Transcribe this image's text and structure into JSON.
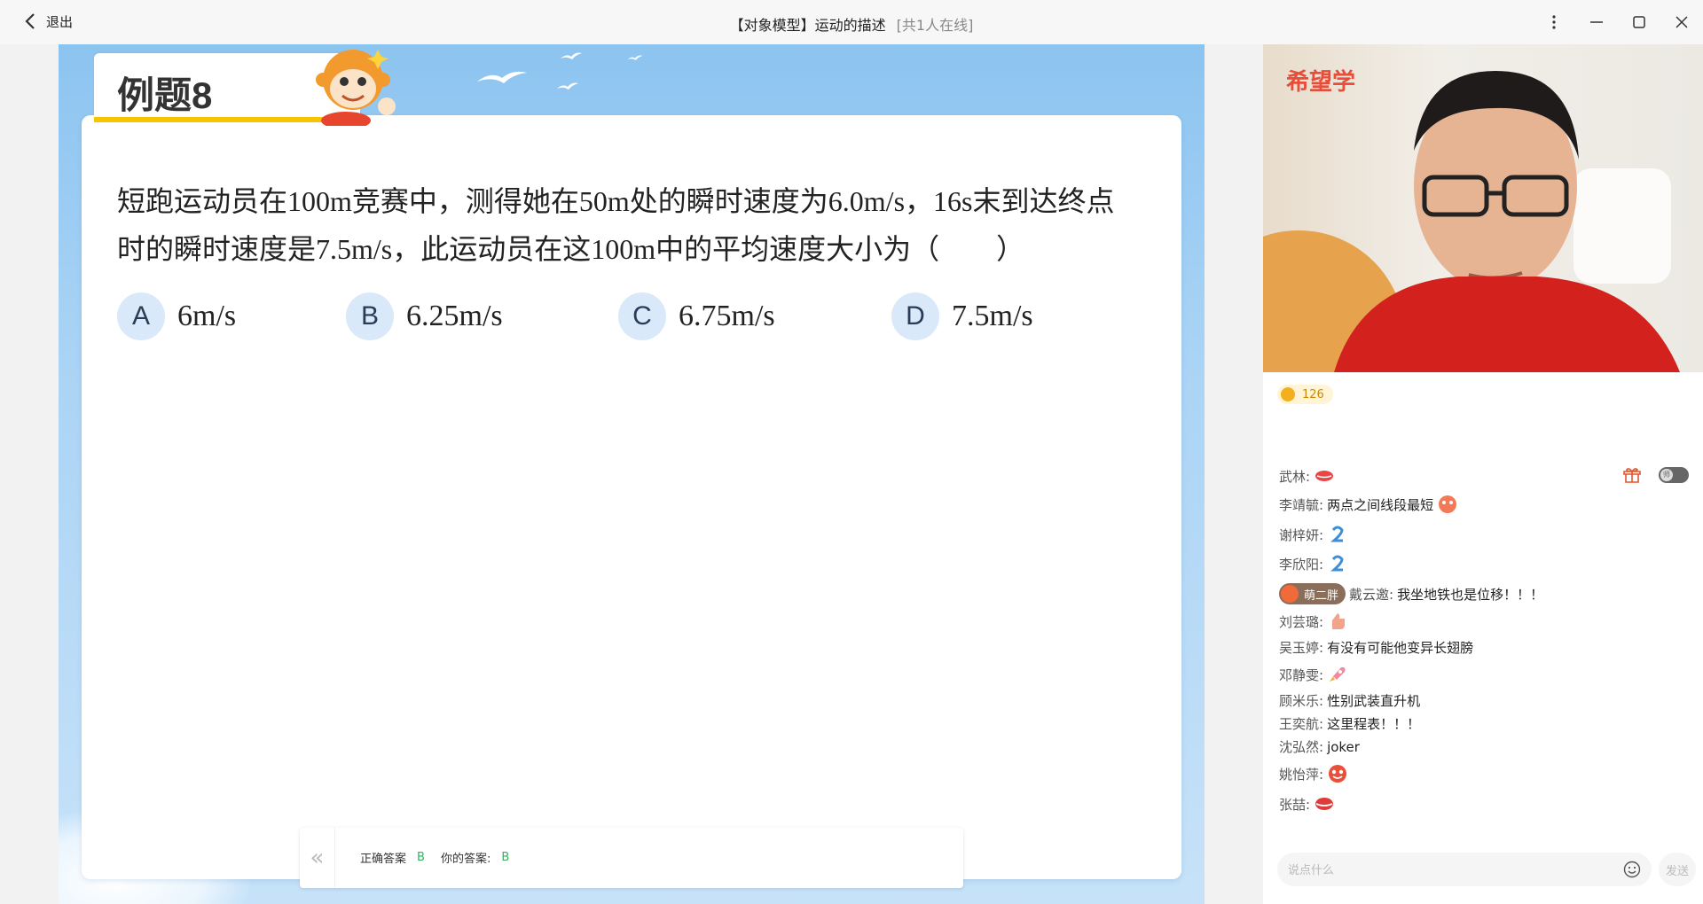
{
  "window": {
    "back_label": "退出",
    "title": "【对象模型】运动的描述",
    "online": "[共1人在线]"
  },
  "slide": {
    "tab_title": "例题8",
    "question_line1": "短跑运动员在100m竞赛中，测得她在50m处的瞬时速度为6.0m/s，16s末到达终点",
    "question_line2": "时的瞬时速度是7.5m/s，此运动员在这100m中的平均速度大小为（　　）",
    "options": [
      {
        "letter": "A",
        "text": "6m/s"
      },
      {
        "letter": "B",
        "text": "6.25m/s"
      },
      {
        "letter": "C",
        "text": "6.75m/s"
      },
      {
        "letter": "D",
        "text": "7.5m/s"
      }
    ],
    "answer": {
      "correct_label": "正确答案",
      "correct_value": "B",
      "yours_label": "你的答案:",
      "yours_value": "B"
    }
  },
  "side": {
    "video_logo": "希望学",
    "coins": "126",
    "chat": [
      {
        "name": "武林:",
        "text": ""
      },
      {
        "name": "李靖毓:",
        "text": "两点之间线段最短"
      },
      {
        "name": "谢梓妍:",
        "text": ""
      },
      {
        "name": "李欣阳:",
        "text": ""
      },
      {
        "badge": "萌二胖",
        "name": "戴云邀:",
        "text": "我坐地铁也是位移！！！"
      },
      {
        "name": "刘芸璐:",
        "text": ""
      },
      {
        "name": "吴玉婷:",
        "text": "有没有可能他变异长翅膀"
      },
      {
        "name": "邓静雯:",
        "text": ""
      },
      {
        "name": "顾米乐:",
        "text": "性别武装直升机"
      },
      {
        "name": "王奕航:",
        "text": "这里程表！！！"
      },
      {
        "name": "沈弘然:",
        "text": "joker"
      },
      {
        "name": "姚怡萍:",
        "text": ""
      },
      {
        "name": "张喆:",
        "text": ""
      }
    ],
    "toggle_label": "师",
    "input_placeholder": "说点什么",
    "send_label": "发送"
  }
}
